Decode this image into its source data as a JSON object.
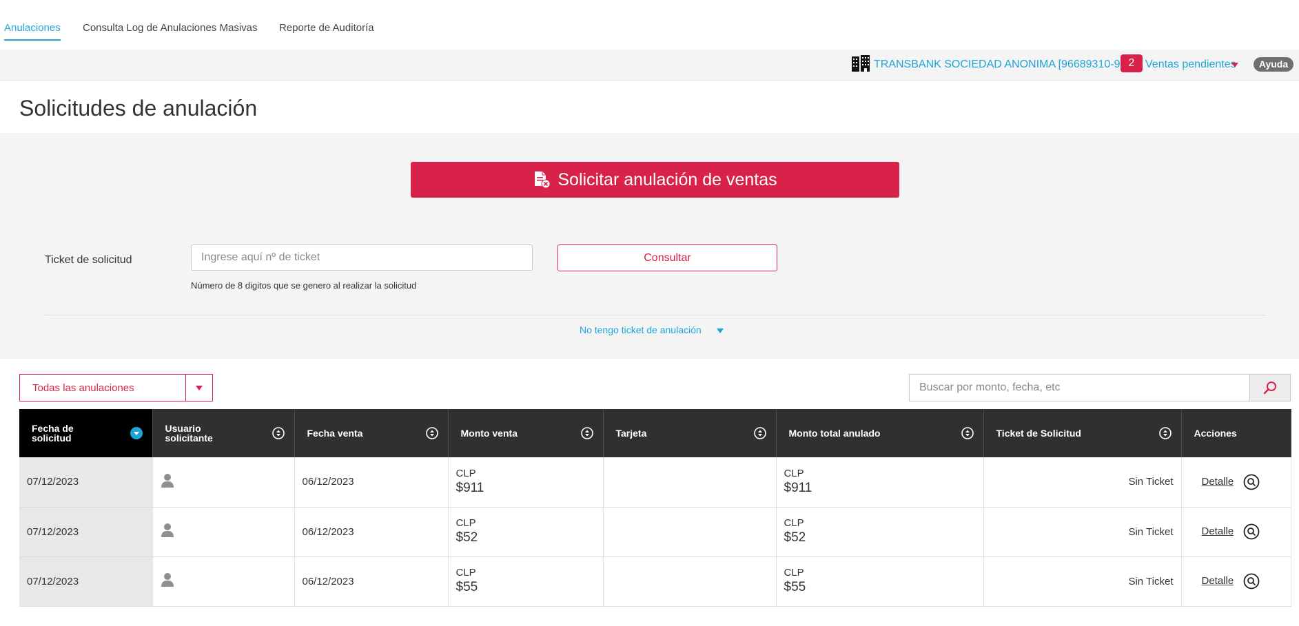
{
  "tabs": [
    {
      "label": "Anulaciones",
      "active": true
    },
    {
      "label": "Consulta Log de Anulaciones Masivas",
      "active": false
    },
    {
      "label": "Reporte de Auditoría",
      "active": false
    }
  ],
  "company_bar": {
    "company_name": "TRANSBANK SOCIEDAD ANONIMA [96689310-9]",
    "pending_count": "2",
    "pending_label": "Ventas pendientes",
    "help_label": "Ayuda"
  },
  "page_title": "Solicitudes de anulación",
  "request_panel": {
    "request_button_label": "Solicitar anulación de ventas",
    "ticket_label": "Ticket de solicitud",
    "ticket_placeholder": "Ingrese aquí nº de ticket",
    "consult_button_label": "Consultar",
    "ticket_hint": "Número de 8 digitos que se genero al realizar la solicitud",
    "no_ticket_link": "No tengo ticket de anulación"
  },
  "filter": {
    "selected": "Todas las anulaciones"
  },
  "search": {
    "placeholder": "Buscar por monto, fecha, etc"
  },
  "table": {
    "columns": [
      "Fecha de solicitud",
      "Usuario solicitante",
      "Fecha venta",
      "Monto venta",
      "Tarjeta",
      "Monto total anulado",
      "Ticket de Solicitud",
      "Acciones"
    ],
    "rows": [
      {
        "fecha_solicitud": "07/12/2023",
        "fecha_venta": "06/12/2023",
        "monto_currency": "CLP",
        "monto_venta": "$911",
        "tarjeta": "",
        "anulado_currency": "CLP",
        "monto_anulado": "$911",
        "ticket": "Sin Ticket",
        "action": "Detalle"
      },
      {
        "fecha_solicitud": "07/12/2023",
        "fecha_venta": "06/12/2023",
        "monto_currency": "CLP",
        "monto_venta": "$52",
        "tarjeta": "",
        "anulado_currency": "CLP",
        "monto_anulado": "$52",
        "ticket": "Sin Ticket",
        "action": "Detalle"
      },
      {
        "fecha_solicitud": "07/12/2023",
        "fecha_venta": "06/12/2023",
        "monto_currency": "CLP",
        "monto_venta": "$55",
        "tarjeta": "",
        "anulado_currency": "CLP",
        "monto_anulado": "$55",
        "ticket": "Sin Ticket",
        "action": "Detalle"
      }
    ]
  },
  "colors": {
    "accent_blue": "#1ea5d8",
    "brand_red": "#d9224a",
    "header_dark": "#2e3032"
  }
}
